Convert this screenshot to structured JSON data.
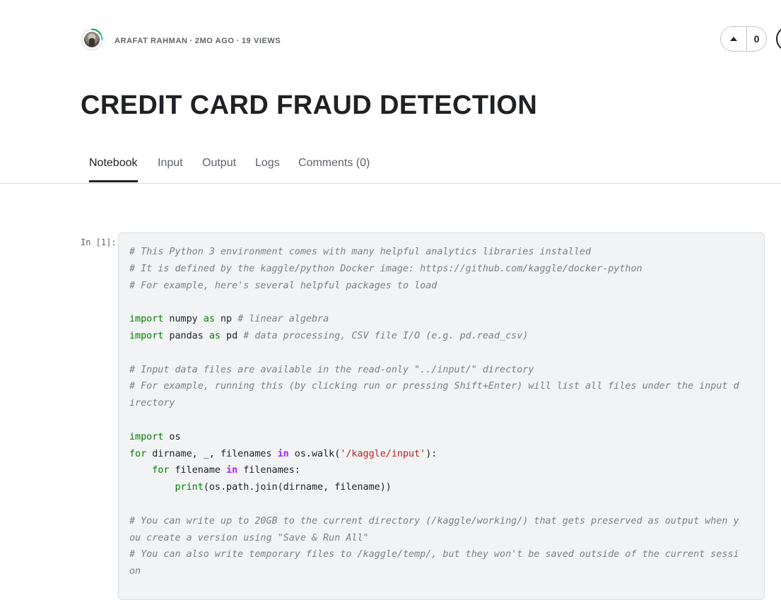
{
  "header": {
    "author": "ARAFAT RAHMAN",
    "age": "2MO AGO",
    "views": "19 VIEWS",
    "separator": "·",
    "vote_count": "0"
  },
  "title": "CREDIT CARD FRAUD DETECTION",
  "tabs": [
    {
      "label": "Notebook",
      "active": true
    },
    {
      "label": "Input",
      "active": false
    },
    {
      "label": "Output",
      "active": false
    },
    {
      "label": "Logs",
      "active": false
    },
    {
      "label": "Comments (0)",
      "active": false
    }
  ],
  "cell": {
    "prompt": "In [1]:",
    "lines": [
      [
        [
          "c",
          "# This Python 3 environment comes with many helpful analytics libraries installed"
        ]
      ],
      [
        [
          "c",
          "# It is defined by the kaggle/python Docker image: https://github.com/kaggle/docker-python"
        ]
      ],
      [
        [
          "c",
          "# For example, here's several helpful packages to load"
        ]
      ],
      [],
      [
        [
          "k",
          "import"
        ],
        [
          "",
          " numpy "
        ],
        [
          "k",
          "as"
        ],
        [
          "",
          " np "
        ],
        [
          "c",
          "# linear algebra"
        ]
      ],
      [
        [
          "k",
          "import"
        ],
        [
          "",
          " pandas "
        ],
        [
          "k",
          "as"
        ],
        [
          "",
          " pd "
        ],
        [
          "c",
          "# data processing, CSV file I/O (e.g. pd.read_csv)"
        ]
      ],
      [],
      [
        [
          "c",
          "# Input data files are available in the read-only \"../input/\" directory"
        ]
      ],
      [
        [
          "c",
          "# For example, running this (by clicking run or pressing Shift+Enter) will list all files under the input d"
        ]
      ],
      [
        [
          "c",
          "irectory"
        ]
      ],
      [],
      [
        [
          "k",
          "import"
        ],
        [
          "",
          " os"
        ]
      ],
      [
        [
          "k",
          "for"
        ],
        [
          "",
          " dirname, _, filenames "
        ],
        [
          "o",
          "in"
        ],
        [
          "",
          " os.walk("
        ],
        [
          "s",
          "'/kaggle/input'"
        ],
        [
          "",
          "):"
        ]
      ],
      [
        [
          "",
          "    "
        ],
        [
          "k",
          "for"
        ],
        [
          "",
          " filename "
        ],
        [
          "o",
          "in"
        ],
        [
          "",
          " filenames:"
        ]
      ],
      [
        [
          "",
          "        "
        ],
        [
          "b",
          "print"
        ],
        [
          "",
          "(os.path.join(dirname, filename))"
        ]
      ],
      [],
      [
        [
          "c",
          "# You can write up to 20GB to the current directory (/kaggle/working/) that gets preserved as output when y"
        ]
      ],
      [
        [
          "c",
          "ou create a version using \"Save & Run All\""
        ]
      ],
      [
        [
          "c",
          "# You can also write temporary files to /kaggle/temp/, but they won't be saved outside of the current sessi"
        ]
      ],
      [
        [
          "c",
          "on"
        ]
      ]
    ]
  },
  "colors": {
    "comment": "#7f7f7f",
    "keyword": "#008000",
    "operator": "#aa22ff",
    "string": "#ba2121",
    "cell_bg": "#f1f3f4"
  },
  "icons": {
    "upvote": "triangle-up-icon"
  }
}
